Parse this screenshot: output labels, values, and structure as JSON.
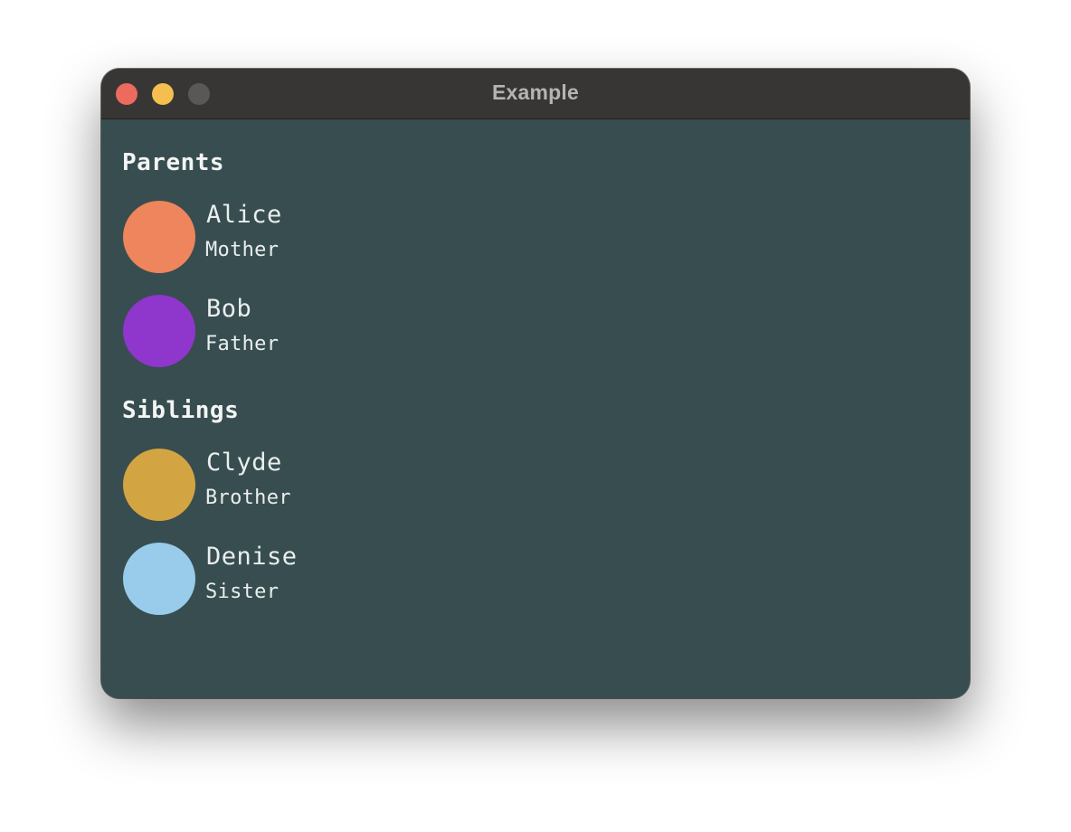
{
  "window": {
    "title": "Example"
  },
  "colors": {
    "window_bg": "#384d4f",
    "titlebar_bg": "#383634",
    "close": "#ec6a5e",
    "minimize": "#f4bf4f",
    "zoom": "#5a5856"
  },
  "sections": [
    {
      "title": "Parents",
      "people": [
        {
          "name": "Alice",
          "relation": "Mother",
          "avatar_color": "#ee855c"
        },
        {
          "name": "Bob",
          "relation": "Father",
          "avatar_color": "#8f36cc"
        }
      ]
    },
    {
      "title": "Siblings",
      "people": [
        {
          "name": "Clyde",
          "relation": "Brother",
          "avatar_color": "#d3a542"
        },
        {
          "name": "Denise",
          "relation": "Sister",
          "avatar_color": "#99cceb"
        }
      ]
    }
  ]
}
